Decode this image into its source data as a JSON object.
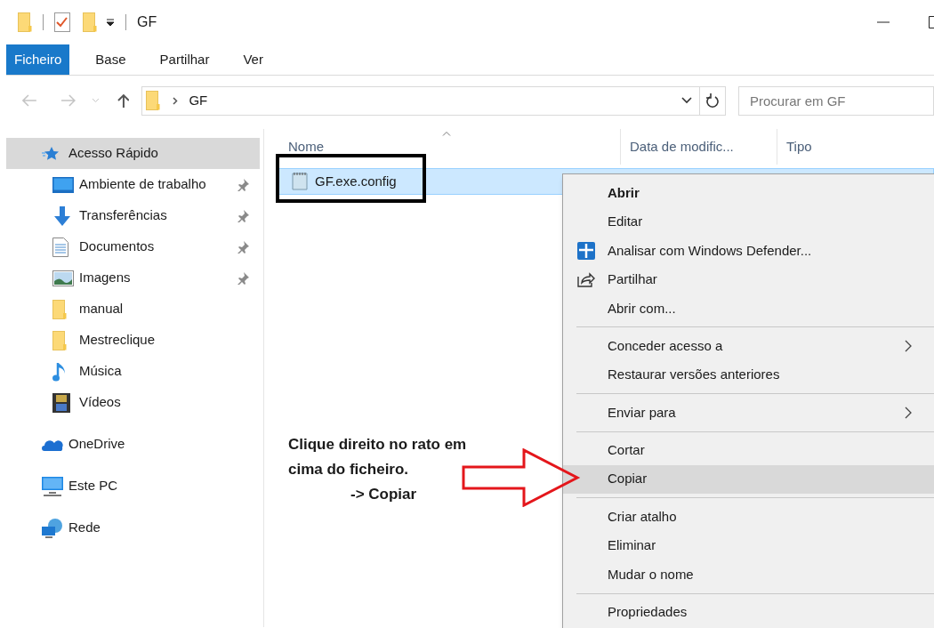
{
  "title_bar": {
    "title": "GF"
  },
  "ribbon_tabs": [
    {
      "label": "Ficheiro",
      "kind": "file",
      "selected": false
    },
    {
      "label": "Base",
      "kind": "tab",
      "selected": false
    },
    {
      "label": "Partilhar",
      "kind": "tab",
      "selected": false
    },
    {
      "label": "Ver",
      "kind": "tab",
      "selected": false
    }
  ],
  "address_bar": {
    "path": "GF"
  },
  "search": {
    "placeholder": "Procurar em GF"
  },
  "sidebar": {
    "items": [
      {
        "label": "Acesso Rápido",
        "kind": "star",
        "selected": true,
        "children": [
          {
            "label": "Ambiente de trabalho",
            "kind": "desktop",
            "pinned": true
          },
          {
            "label": "Transferências",
            "kind": "download",
            "pinned": true
          },
          {
            "label": "Documentos",
            "kind": "document",
            "pinned": true
          },
          {
            "label": "Imagens",
            "kind": "image",
            "pinned": true
          },
          {
            "label": "manual",
            "kind": "folder",
            "pinned": false
          },
          {
            "label": "Mestreclique",
            "kind": "folder",
            "pinned": false
          },
          {
            "label": "Música",
            "kind": "music",
            "pinned": false
          },
          {
            "label": "Vídeos",
            "kind": "video",
            "pinned": false
          }
        ]
      },
      {
        "label": "OneDrive",
        "kind": "cloud",
        "selected": false
      },
      {
        "label": "Este PC",
        "kind": "computer",
        "selected": false
      },
      {
        "label": "Rede",
        "kind": "network",
        "selected": false
      }
    ]
  },
  "file_list": {
    "columns": [
      {
        "label": "Nome",
        "sorted": true
      },
      {
        "label": "Data de modific...",
        "sorted": false
      },
      {
        "label": "Tipo",
        "sorted": false
      }
    ],
    "rows": [
      {
        "name": "GF.exe.config",
        "selected": true
      }
    ]
  },
  "context_menu": {
    "items": [
      {
        "kind": "plain",
        "label": "Abrir",
        "default": true,
        "selected": false
      },
      {
        "kind": "plain",
        "label": "Editar",
        "default": false,
        "selected": false
      },
      {
        "kind": "shield",
        "label": "Analisar com Windows Defender...",
        "default": false,
        "selected": false
      },
      {
        "kind": "share",
        "label": "Partilhar",
        "default": false,
        "selected": false
      },
      {
        "kind": "plain",
        "label": "Abrir com...",
        "default": false,
        "selected": false
      },
      {
        "kind": "separator"
      },
      {
        "kind": "submenu",
        "label": "Conceder acesso a",
        "default": false,
        "selected": false
      },
      {
        "kind": "plain",
        "label": "Restaurar versões anteriores",
        "default": false,
        "selected": false
      },
      {
        "kind": "separator"
      },
      {
        "kind": "submenu",
        "label": "Enviar para",
        "default": false,
        "selected": false
      },
      {
        "kind": "separator"
      },
      {
        "kind": "plain",
        "label": "Cortar",
        "default": false,
        "selected": false
      },
      {
        "kind": "plain",
        "label": "Copiar",
        "default": false,
        "selected": true
      },
      {
        "kind": "separator"
      },
      {
        "kind": "plain",
        "label": "Criar atalho",
        "default": false,
        "selected": false
      },
      {
        "kind": "plain",
        "label": "Eliminar",
        "default": false,
        "selected": false
      },
      {
        "kind": "plain",
        "label": "Mudar o nome",
        "default": false,
        "selected": false
      },
      {
        "kind": "separator"
      },
      {
        "kind": "plain",
        "label": "Propriedades",
        "default": false,
        "selected": false
      }
    ]
  },
  "annotation": {
    "lines": [
      "Clique direito no rato em",
      "cima do ficheiro.",
      "-> Copiar"
    ]
  }
}
